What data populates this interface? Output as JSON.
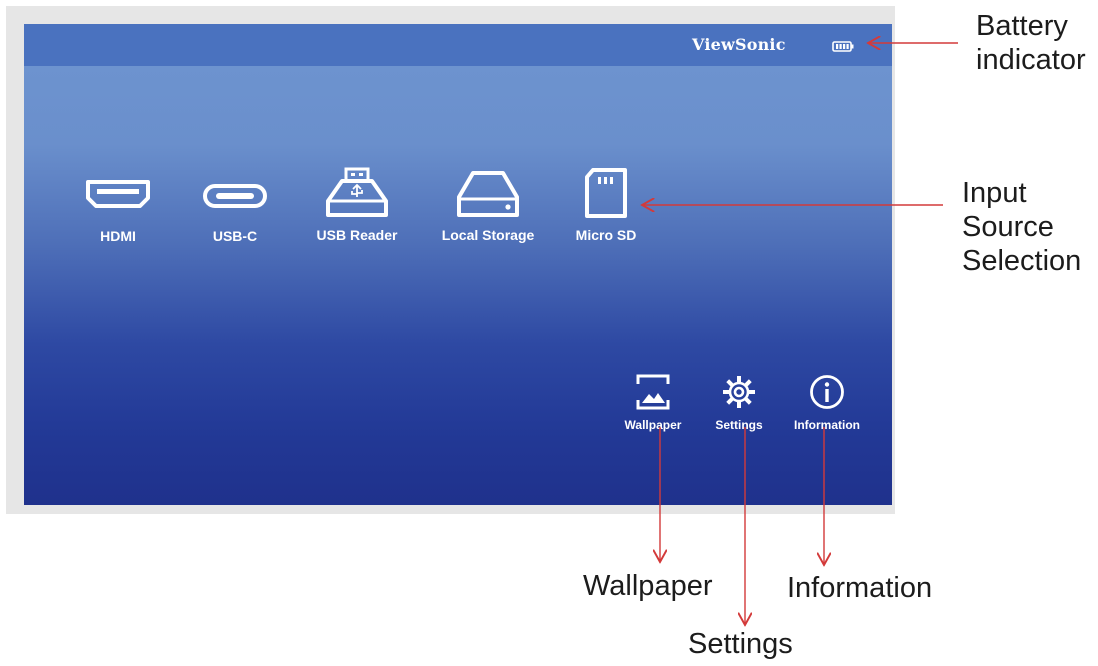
{
  "brand": "ViewSonic",
  "icons": {
    "battery": "battery-icon",
    "hdmi": "hdmi-port-icon",
    "usbc": "usb-c-port-icon",
    "usb_reader": "usb-drive-icon",
    "local_storage": "hard-drive-icon",
    "micro_sd": "sd-card-icon",
    "wallpaper": "image-icon",
    "settings": "gear-icon",
    "information": "info-icon"
  },
  "input_sources": [
    {
      "label": "HDMI"
    },
    {
      "label": "USB-C"
    },
    {
      "label": "USB Reader"
    },
    {
      "label": "Local Storage"
    },
    {
      "label": "Micro SD"
    }
  ],
  "utilities": [
    {
      "label": "Wallpaper"
    },
    {
      "label": "Settings"
    },
    {
      "label": "Information"
    }
  ],
  "callouts": {
    "battery": "Battery indicator",
    "input": "Input Source Selection",
    "wallpaper": "Wallpaper",
    "settings": "Settings",
    "information": "Information"
  },
  "colors": {
    "topbar": "#4a72bf",
    "screen_bottom": "#1f318c",
    "icon": "#ffffff",
    "arrow": "#d33a3a"
  }
}
